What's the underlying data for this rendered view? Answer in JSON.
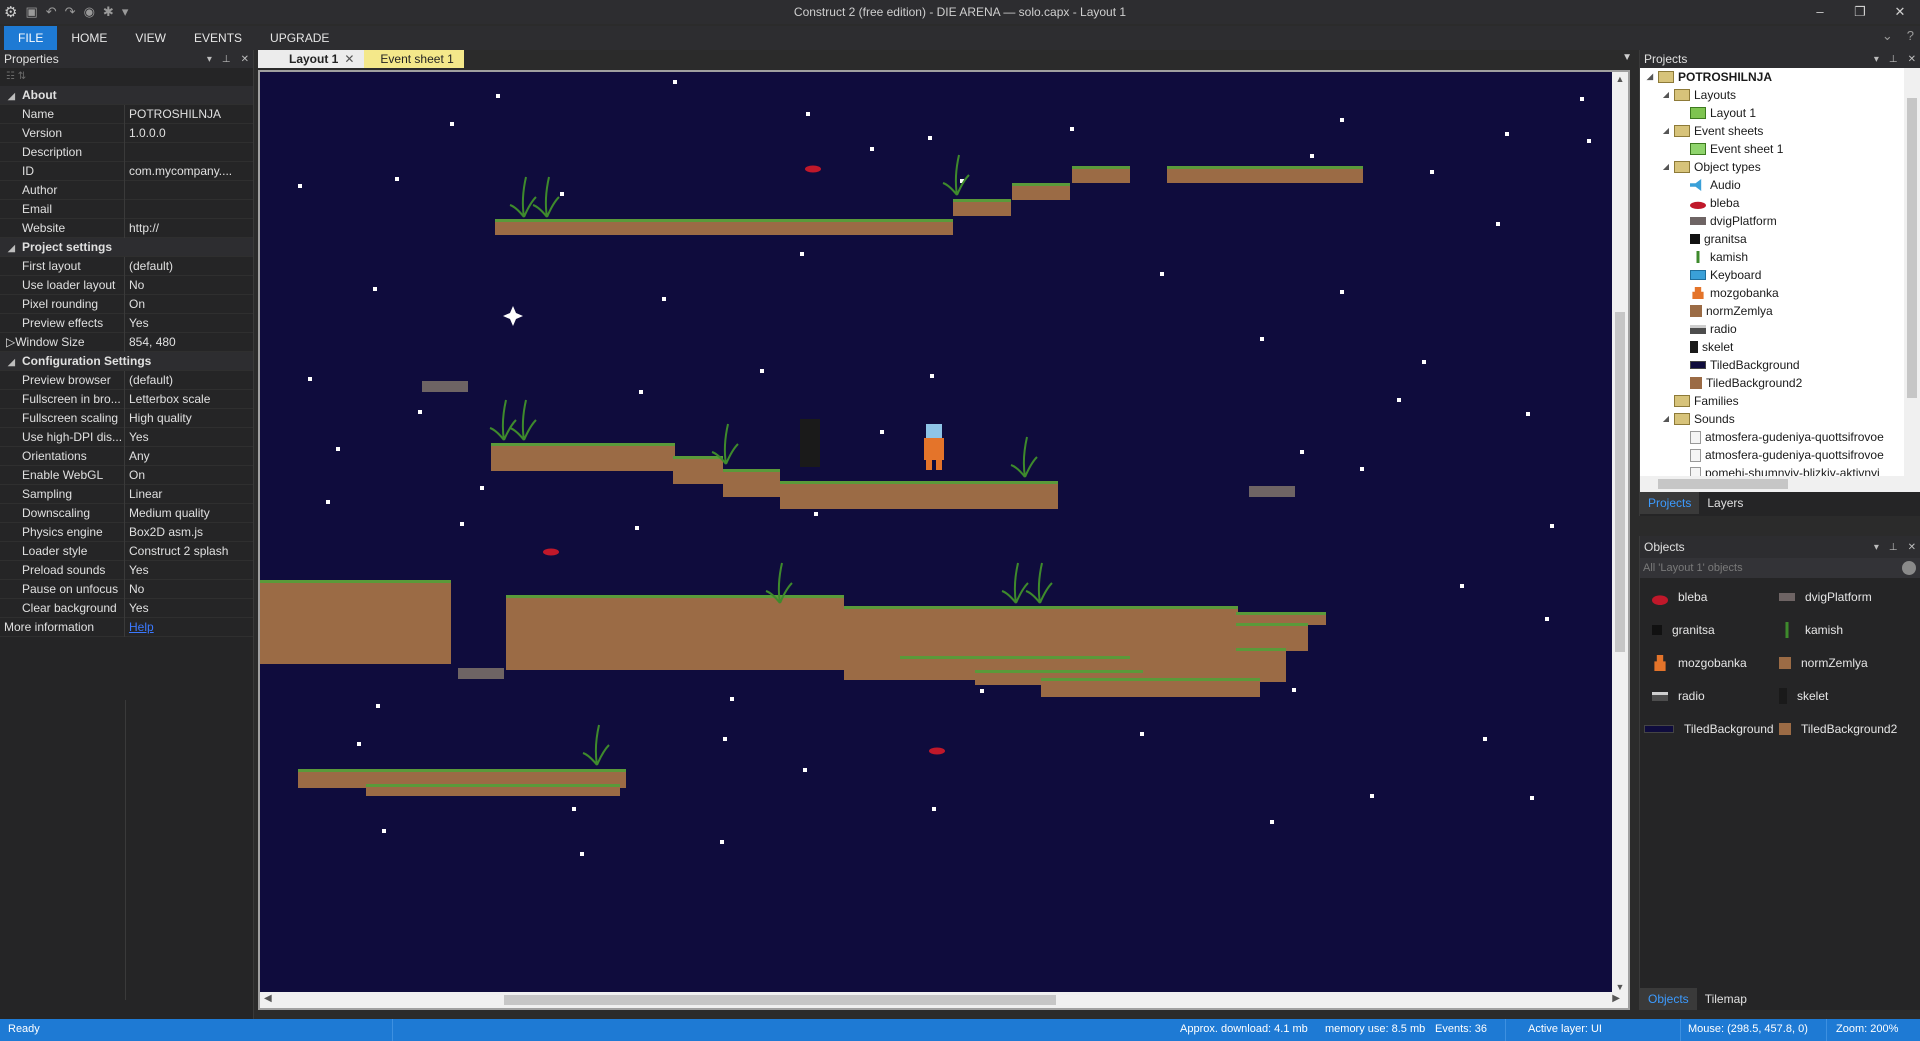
{
  "window": {
    "title": "Construct 2  (free edition) - DIE ARENA — solo.capx - Layout 1"
  },
  "ribbon": {
    "tabs": [
      "FILE",
      "HOME",
      "VIEW",
      "EVENTS",
      "UPGRADE"
    ]
  },
  "properties": {
    "title": "Properties",
    "rows": [
      {
        "type": "cat",
        "name": "About"
      },
      {
        "name": "Name",
        "value": "POTROSHILNJA"
      },
      {
        "name": "Version",
        "value": "1.0.0.0"
      },
      {
        "name": "Description",
        "value": ""
      },
      {
        "name": "ID",
        "value": "com.mycompany...."
      },
      {
        "name": "Author",
        "value": ""
      },
      {
        "name": "Email",
        "value": ""
      },
      {
        "name": "Website",
        "value": "http://"
      },
      {
        "type": "cat",
        "name": "Project settings"
      },
      {
        "name": "First layout",
        "value": "(default)"
      },
      {
        "name": "Use loader layout",
        "value": "No"
      },
      {
        "name": "Pixel rounding",
        "value": "On"
      },
      {
        "name": "Preview effects",
        "value": "Yes"
      },
      {
        "type": "exp",
        "name": "Window Size",
        "value": "854, 480"
      },
      {
        "type": "cat",
        "name": "Configuration Settings"
      },
      {
        "name": "Preview browser",
        "value": "(default)"
      },
      {
        "name": "Fullscreen in bro...",
        "value": "Letterbox scale"
      },
      {
        "name": "Fullscreen scaling",
        "value": "High quality"
      },
      {
        "name": "Use high-DPI dis...",
        "value": "Yes"
      },
      {
        "name": "Orientations",
        "value": "Any"
      },
      {
        "name": "Enable WebGL",
        "value": "On"
      },
      {
        "name": "Sampling",
        "value": "Linear"
      },
      {
        "name": "Downscaling",
        "value": "Medium quality"
      },
      {
        "name": "Physics engine",
        "value": "Box2D asm.js"
      },
      {
        "name": "Loader style",
        "value": "Construct 2 splash"
      },
      {
        "name": "Preload sounds",
        "value": "Yes"
      },
      {
        "name": "Pause on unfocus",
        "value": "No"
      },
      {
        "name": "Clear background",
        "value": "Yes"
      },
      {
        "type": "more",
        "name": "More information",
        "value": "Help"
      }
    ]
  },
  "doc_tabs": {
    "layout": "Layout 1",
    "events": "Event sheet 1"
  },
  "projects": {
    "title": "Projects",
    "tree": [
      {
        "label": "POTROSHILNJA",
        "level": 0,
        "icon": "folder",
        "exp": "◢",
        "root": true
      },
      {
        "label": "Layouts",
        "level": 1,
        "icon": "folder",
        "exp": "◢"
      },
      {
        "label": "Layout 1",
        "level": 2,
        "icon": "layout",
        "exp": ""
      },
      {
        "label": "Event sheets",
        "level": 1,
        "icon": "folder",
        "exp": "◢"
      },
      {
        "label": "Event sheet 1",
        "level": 2,
        "icon": "events",
        "exp": ""
      },
      {
        "label": "Object types",
        "level": 1,
        "icon": "folder",
        "exp": "◢"
      },
      {
        "label": "Audio",
        "level": 2,
        "icon": "audio",
        "exp": ""
      },
      {
        "label": "bleba",
        "level": 2,
        "icon": "bleba",
        "exp": ""
      },
      {
        "label": "dvigPlatform",
        "level": 2,
        "icon": "dvig",
        "exp": ""
      },
      {
        "label": "granitsa",
        "level": 2,
        "icon": "granitsa",
        "exp": ""
      },
      {
        "label": "kamish",
        "level": 2,
        "icon": "kamish",
        "exp": ""
      },
      {
        "label": "Keyboard",
        "level": 2,
        "icon": "keyboard",
        "exp": ""
      },
      {
        "label": "mozgobanka",
        "level": 2,
        "icon": "mozgo",
        "exp": ""
      },
      {
        "label": "normZemlya",
        "level": 2,
        "icon": "norm",
        "exp": ""
      },
      {
        "label": "radio",
        "level": 2,
        "icon": "radio",
        "exp": ""
      },
      {
        "label": "skelet",
        "level": 2,
        "icon": "skelet",
        "exp": ""
      },
      {
        "label": "TiledBackground",
        "level": 2,
        "icon": "tiled",
        "exp": ""
      },
      {
        "label": "TiledBackground2",
        "level": 2,
        "icon": "tiled2",
        "exp": ""
      },
      {
        "label": "Families",
        "level": 1,
        "icon": "folder",
        "exp": ""
      },
      {
        "label": "Sounds",
        "level": 1,
        "icon": "folder",
        "exp": "◢"
      },
      {
        "label": "atmosfera-gudeniya-quottsifrovoe",
        "level": 2,
        "icon": "sound",
        "exp": ""
      },
      {
        "label": "atmosfera-gudeniya-quottsifrovoe",
        "level": 2,
        "icon": "sound",
        "exp": ""
      },
      {
        "label": "pomehi-shumnyiy-blizkiy-aktivnyi",
        "level": 2,
        "icon": "sound",
        "exp": ""
      }
    ],
    "tabs": [
      "Projects",
      "Layers"
    ]
  },
  "objects": {
    "title": "Objects",
    "filter_placeholder": "All 'Layout 1' objects",
    "items": [
      {
        "label": "bleba",
        "icon": "bleba"
      },
      {
        "label": "dvigPlatform",
        "icon": "dvig"
      },
      {
        "label": "granitsa",
        "icon": "granitsa"
      },
      {
        "label": "kamish",
        "icon": "kamish"
      },
      {
        "label": "mozgobanka",
        "icon": "mozgo"
      },
      {
        "label": "normZemlya",
        "icon": "norm"
      },
      {
        "label": "radio",
        "icon": "radio"
      },
      {
        "label": "skelet",
        "icon": "skelet"
      },
      {
        "label": "TiledBackground",
        "icon": "tiled"
      },
      {
        "label": "TiledBackground2",
        "icon": "tiled2"
      }
    ],
    "tabs": [
      "Objects",
      "Tilemap"
    ]
  },
  "status": {
    "ready": "Ready",
    "download": "Approx. download: 4.1 mb",
    "memory": "memory use: 8.5 mb",
    "events": "Events: 36",
    "active_layer": "Active layer: UI",
    "mouse": "Mouse: (298.5, 457.8, 0)",
    "zoom": "Zoom: 200%"
  },
  "colors": {
    "accent": "#1e7ad4",
    "sky": "#0f0c3d",
    "dirt": "#9b6b45",
    "grass": "#5a9a3a",
    "event_tab": "#f4e88a"
  }
}
